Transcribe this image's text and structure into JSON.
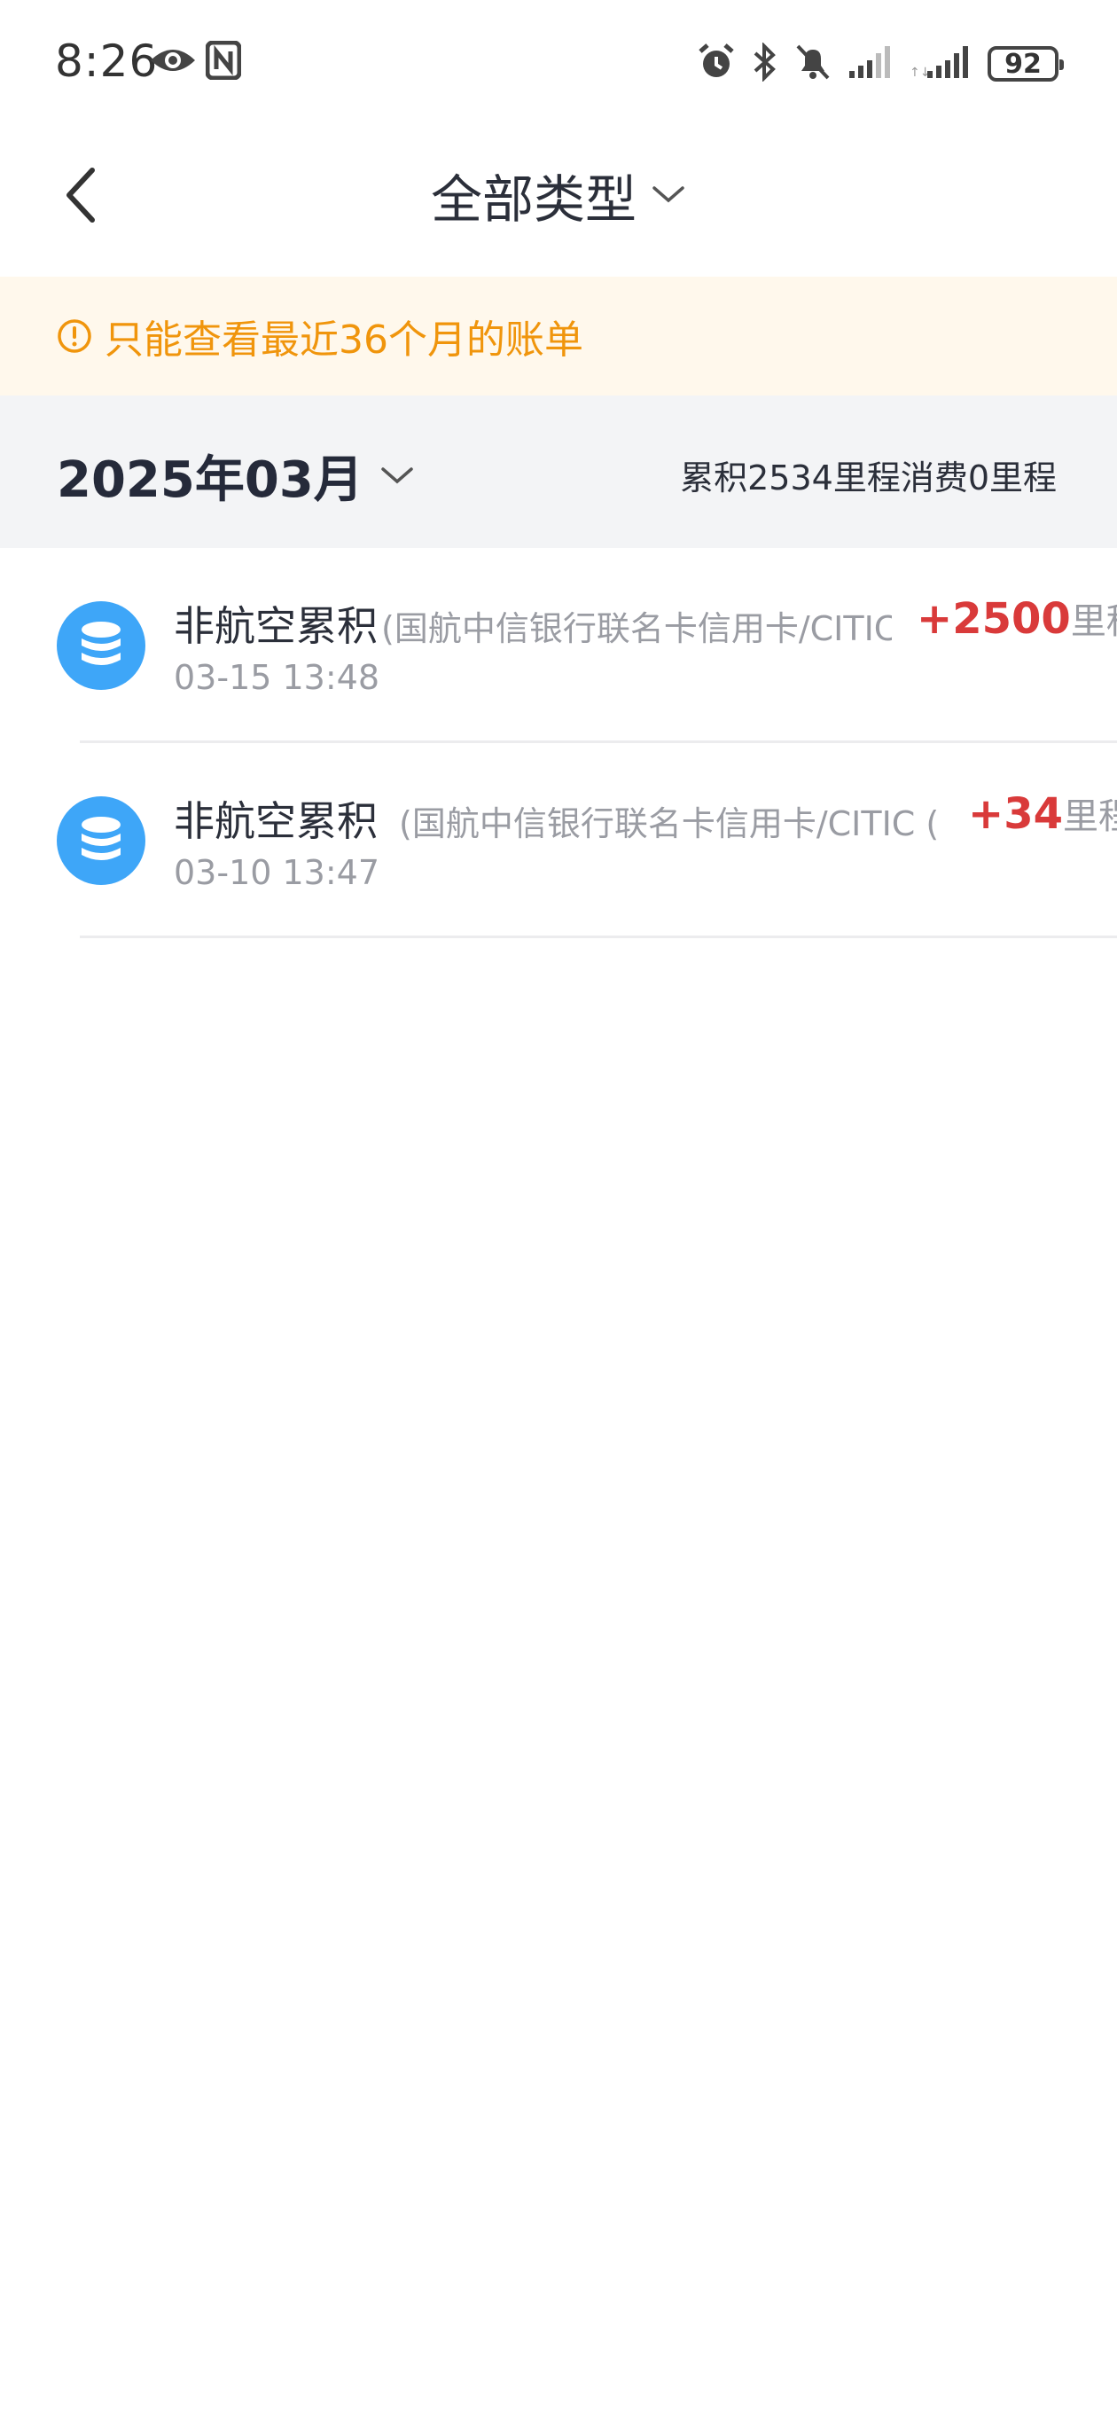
{
  "status_bar": {
    "time": "8:26",
    "battery": "92",
    "icons": [
      "eye-icon",
      "nfc-icon",
      "alarm-icon",
      "bluetooth-icon",
      "bell-off-icon",
      "signal-icon",
      "signal-icon"
    ]
  },
  "header": {
    "title": "全部类型"
  },
  "notice": {
    "text": "只能查看最近36个月的账单",
    "color": "#f0950c"
  },
  "month_bar": {
    "month": "2025年03月",
    "summary": "累积2534里程消费0里程"
  },
  "transactions": [
    {
      "title": "非航空累积",
      "description": "(国航中信银行联名卡信用卡/CITIC",
      "time": "03-15 13:48",
      "amount": "+2500",
      "unit": "里程"
    },
    {
      "title": "非航空累积",
      "description": "(国航中信银行联名卡信用卡/CITIC (",
      "time": "03-10 13:47",
      "amount": "+34",
      "unit": "里程"
    }
  ],
  "colors": {
    "accent_red": "#d93a3a",
    "icon_blue": "#3ea6f8",
    "notice_bg": "#fff8ec"
  }
}
